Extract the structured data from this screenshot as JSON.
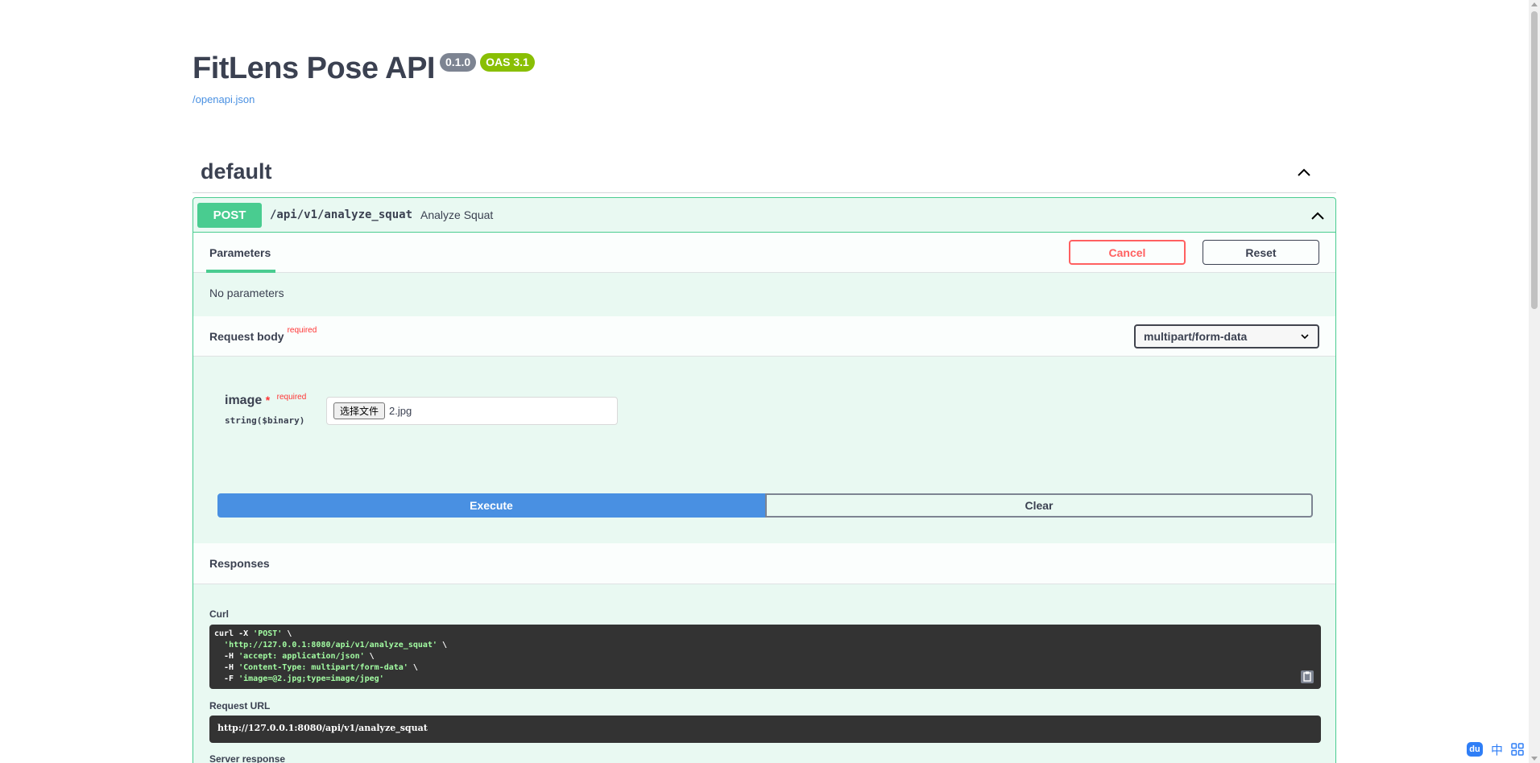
{
  "info": {
    "title": "FitLens Pose API",
    "version_badge": "0.1.0",
    "oas_badge": "OAS 3.1",
    "spec_link": "/openapi.json"
  },
  "tag": {
    "name": "default",
    "chevron_icon": "chevron-up-icon"
  },
  "operation": {
    "method": "POST",
    "path": "/api/v1/analyze_squat",
    "summary": "Analyze Squat",
    "parameters_tab": "Parameters",
    "cancel_label": "Cancel",
    "reset_label": "Reset",
    "no_parameters": "No parameters",
    "request_body": {
      "title": "Request body",
      "required_label": "required",
      "content_type": "multipart/form-data"
    },
    "param": {
      "name": "image",
      "star": "*",
      "required_label": "required",
      "type": "string($binary)",
      "file_button": "选择文件",
      "file_name": "2.jpg"
    },
    "execute_label": "Execute",
    "clear_label": "Clear",
    "responses_title": "Responses",
    "curl_label": "Curl",
    "curl_lines": [
      {
        "cmd": "curl -X ",
        "str": "'POST'",
        "tail": " \\"
      },
      {
        "cmd": "  ",
        "str": "'http://127.0.0.1:8080/api/v1/analyze_squat'",
        "tail": " \\"
      },
      {
        "cmd": "  -H ",
        "str": "'accept: application/json'",
        "tail": " \\"
      },
      {
        "cmd": "  -H ",
        "str": "'Content-Type: multipart/form-data'",
        "tail": " \\"
      },
      {
        "cmd": "  -F ",
        "str": "'image=@2.jpg;type=image/jpeg'",
        "tail": ""
      }
    ],
    "request_url_label": "Request URL",
    "request_url": "http://127.0.0.1:8080/api/v1/analyze_squat",
    "server_response_label": "Server response"
  },
  "ime": {
    "paw": "du",
    "lang": "中",
    "grid_icon": "grid-icon"
  },
  "colors": {
    "post_green": "#49cc90",
    "execute_blue": "#4990e2",
    "cancel_red": "#ff6060",
    "version_badge_gray": "#7d8492",
    "oas_badge_green": "#89bf04",
    "code_bg": "#333333"
  }
}
